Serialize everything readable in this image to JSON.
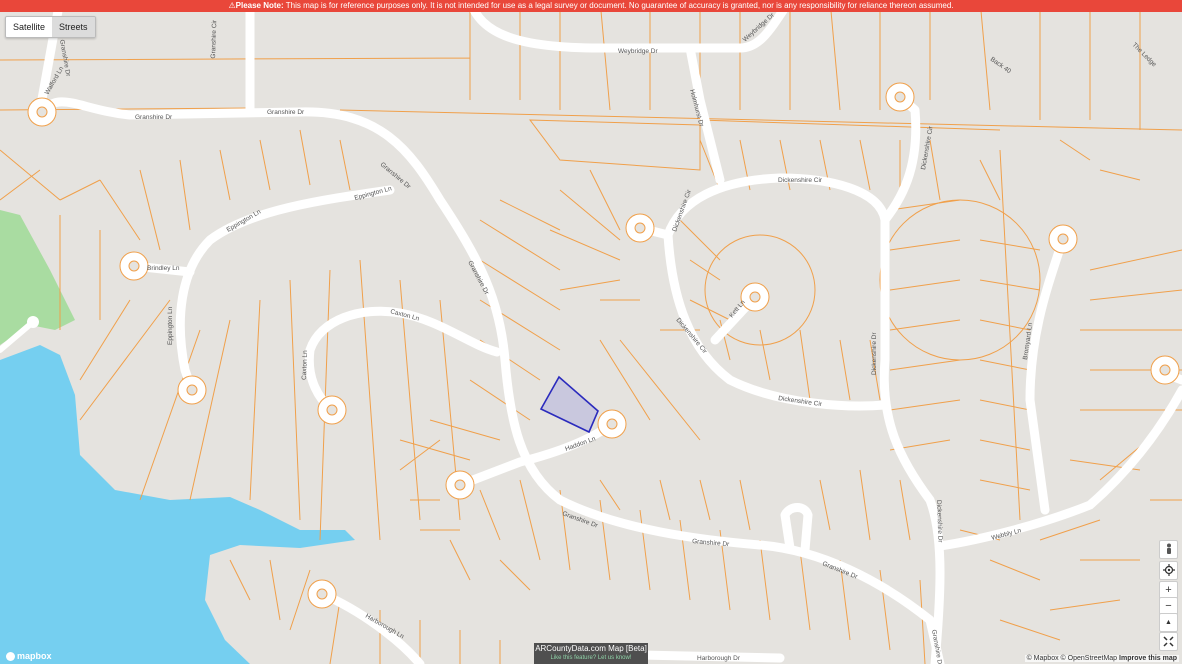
{
  "notice": {
    "prefix": "Please Note:",
    "text": "This map is for reference purposes only. It is not intended for use as a legal survey or document. No guarantee of accuracy is granted, nor is any responsibility for reliance thereon assumed."
  },
  "layer_toggle": {
    "satellite": "Satellite",
    "streets": "Streets",
    "active": "satellite"
  },
  "controls": {
    "zoom_in": "+",
    "zoom_out": "−",
    "compass": "▲"
  },
  "streets": {
    "weybridge": "Weybridge Dr",
    "holmesdale": "Holmhurst Dr",
    "back40": "Back 40",
    "the_ledge": "The Ledge",
    "walford": "Walford Ln",
    "granshire": "Granshire Dr",
    "granshire_cir": "Granshire Cir",
    "dickenshire": "Dickenshire Cir",
    "dickenshire_dr": "Dickenshire Dr",
    "eppington": "Eppington Ln",
    "brindley": "Brindley Ln",
    "caxton": "Caxton Ln",
    "haddon": "Haddon Ln",
    "kett": "Kett Ln",
    "bromyard": "Bromyard Ln",
    "webbly": "Webbly Ln",
    "harborough": "Harborough Ln",
    "harborough_dr": "Harborough Dr"
  },
  "brand": {
    "title": "ARCountyData.com Map [Beta]",
    "sub": "Like this feature? Let us know!"
  },
  "logo": "mapbox",
  "attribution": {
    "mapbox": "© Mapbox",
    "osm": "© OpenStreetMap",
    "improve": "Improve this map"
  },
  "colors": {
    "parcel": "#f0a04b",
    "road": "#ffffff",
    "land": "#e5e3df",
    "water": "#75cff0",
    "park": "#a9dca1",
    "highlight": "#2b2bbd",
    "notice": "#e9473a"
  }
}
